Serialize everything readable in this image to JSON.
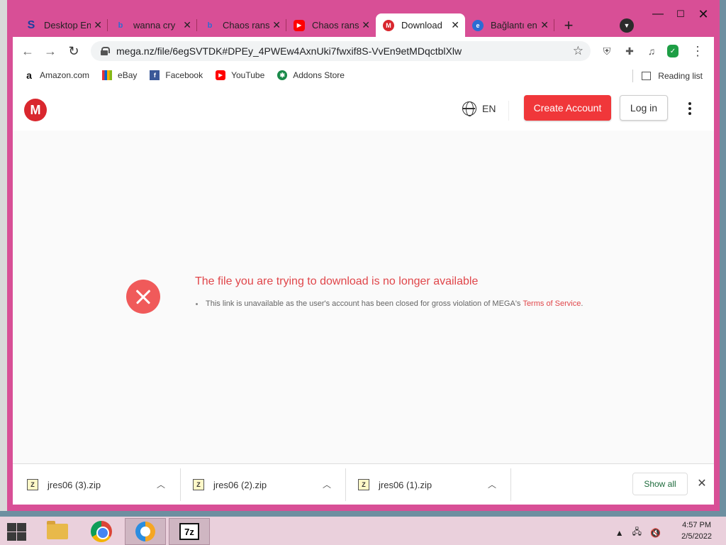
{
  "browser": {
    "tabs": [
      {
        "title": "Desktop En",
        "favicon": "s-icon",
        "favicon_color": "#1b3fa0"
      },
      {
        "title": "wanna cry",
        "favicon": "bing-icon",
        "favicon_color": "#2b6cd4"
      },
      {
        "title": "Chaos rans",
        "favicon": "bing-icon",
        "favicon_color": "#2b6cd4"
      },
      {
        "title": "Chaos rans",
        "favicon": "youtube-icon",
        "favicon_color": "#ff0000"
      },
      {
        "title": "Download",
        "favicon": "mega-icon",
        "favicon_color": "#d9272e",
        "active": true
      },
      {
        "title": "Bağlantı en",
        "favicon": "edge-icon",
        "favicon_color": "#2b6cd4"
      }
    ],
    "new_tab_symbol": "+",
    "address": "mega.nz/file/6egSVTDK#DPEy_4PWEw4AxnUki7fwxif8S-VvEn9etMDqctblXlw",
    "bookmarks": [
      {
        "label": "Amazon.com",
        "icon": "amazon-icon"
      },
      {
        "label": "eBay",
        "icon": "ebay-icon"
      },
      {
        "label": "Facebook",
        "icon": "facebook-icon"
      },
      {
        "label": "YouTube",
        "icon": "youtube-icon"
      },
      {
        "label": "Addons Store",
        "icon": "addons-icon"
      }
    ],
    "reading_list": "Reading list"
  },
  "page": {
    "lang": "EN",
    "create_account": "Create Account",
    "login": "Log in",
    "error_title": "The file you are trying to download is no longer available",
    "error_detail": "This link is unavailable as the user's account has been closed for gross violation of MEGA's",
    "error_link": "Terms of Service",
    "error_tail": ".",
    "brand_color": "#d9272e",
    "accent_color": "#f0373a"
  },
  "downloads": {
    "items": [
      "jres06 (3).zip",
      "jres06 (2).zip",
      "jres06 (1).zip"
    ],
    "show_all": "Show all"
  },
  "taskbar": {
    "time": "4:57 PM",
    "date": "2/5/2022"
  }
}
